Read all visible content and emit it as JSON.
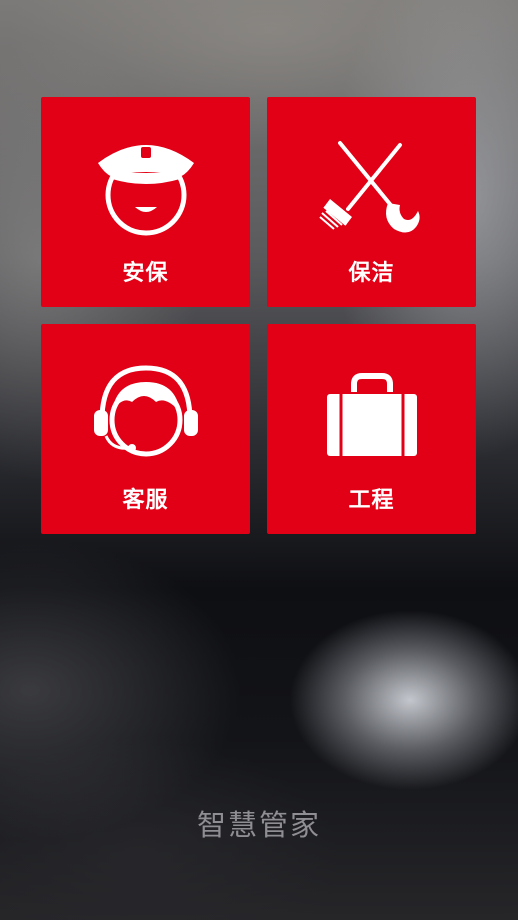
{
  "tiles": [
    {
      "id": "security",
      "label": "安保",
      "icon": "security-guard-icon"
    },
    {
      "id": "cleaning",
      "label": "保洁",
      "icon": "broom-mop-icon"
    },
    {
      "id": "service",
      "label": "客服",
      "icon": "headset-agent-icon"
    },
    {
      "id": "engineering",
      "label": "工程",
      "icon": "toolbox-icon"
    }
  ],
  "app_title": "智慧管家",
  "colors": {
    "tile_background": "#e10016",
    "tile_foreground": "#ffffff",
    "title_text": "#8f8f93"
  }
}
